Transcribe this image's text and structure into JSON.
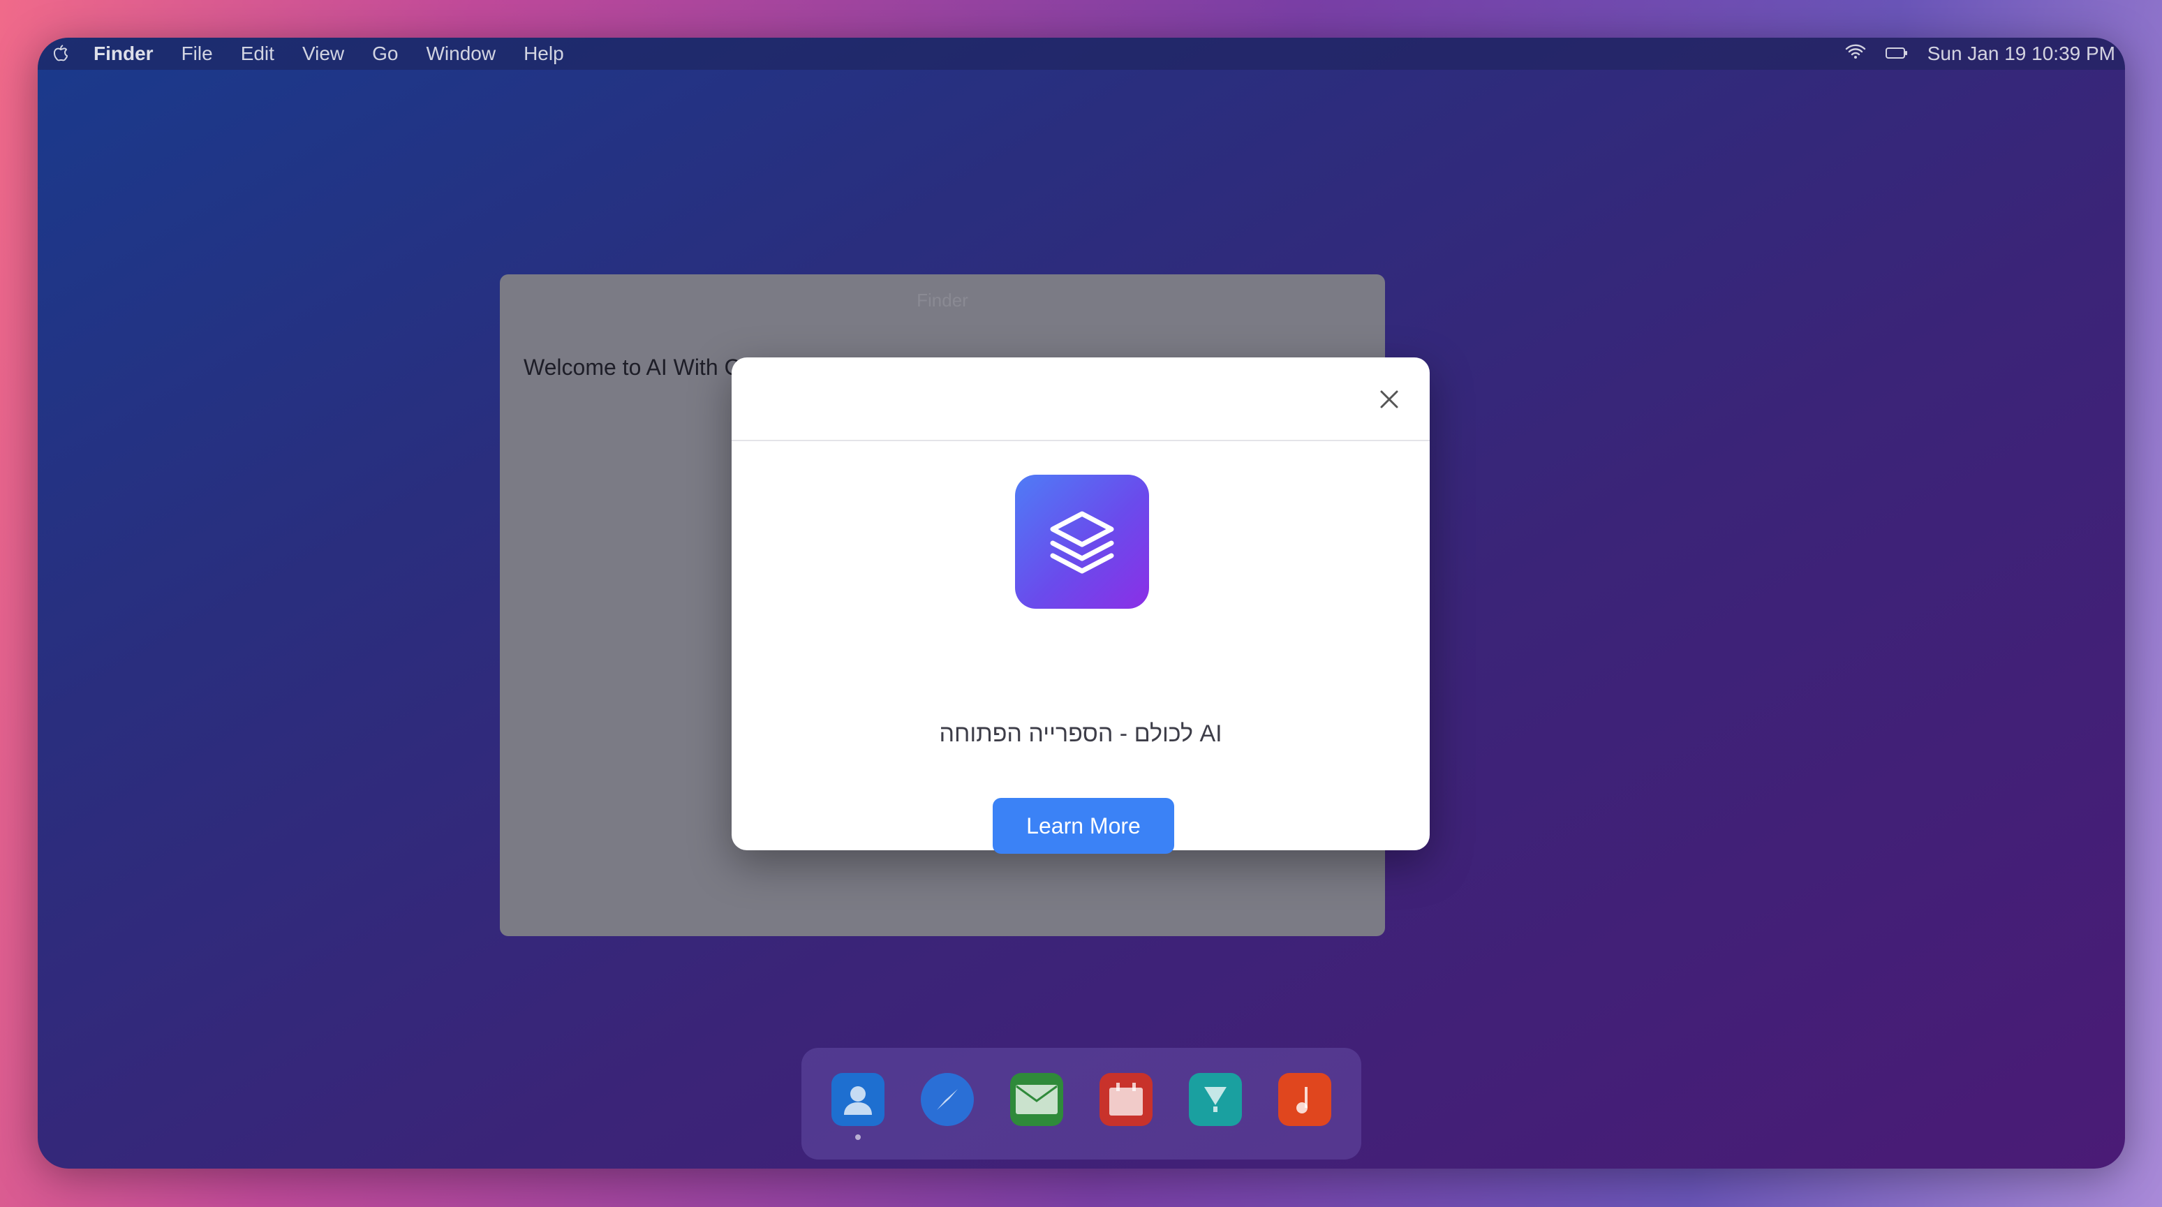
{
  "menubar": {
    "app_name": "Finder",
    "items": [
      "File",
      "Edit",
      "View",
      "Go",
      "Window",
      "Help"
    ],
    "datetime": "Sun Jan 19 10:39 PM",
    "icons": [
      "apple-icon",
      "wifi-icon",
      "battery-icon"
    ]
  },
  "finder_window": {
    "title": "Finder",
    "welcome_text": "Welcome to AI With C"
  },
  "modal": {
    "icon": "layers-icon",
    "text": "AI לכולם - הספרייה הפתוחה",
    "button_label": "Learn More"
  },
  "dock": {
    "items": [
      {
        "name": "contacts",
        "icon": "person-icon",
        "color": "#1e6fd0",
        "active": true
      },
      {
        "name": "safari",
        "icon": "compass-icon",
        "color": "#2a6fd6",
        "active": false
      },
      {
        "name": "mail",
        "icon": "mail-icon",
        "color": "#2f8a3a",
        "active": false
      },
      {
        "name": "calendar",
        "icon": "calendar-icon",
        "color": "#c8322b",
        "active": false
      },
      {
        "name": "app-store",
        "icon": "appstore-icon",
        "color": "#1aa0a0",
        "active": false
      },
      {
        "name": "music",
        "icon": "music-icon",
        "color": "#e0461e",
        "active": false
      }
    ]
  },
  "colors": {
    "accent": "#3b82f6",
    "icon_gradient_start": "#4f7cf6",
    "icon_gradient_end": "#8b2fe6"
  }
}
